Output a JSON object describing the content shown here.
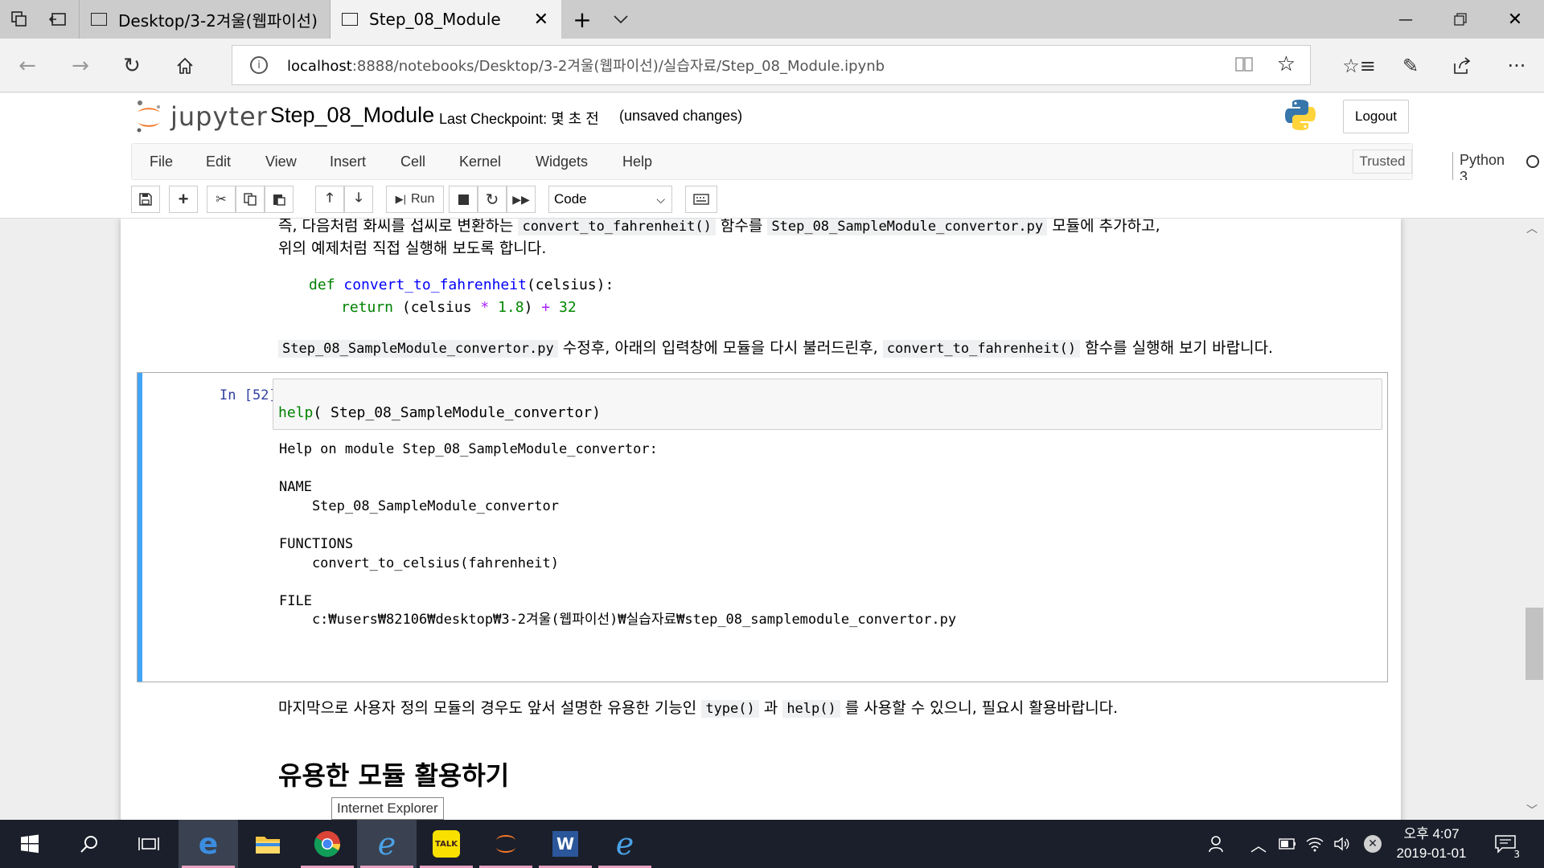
{
  "browser": {
    "tabs": [
      {
        "label": "Desktop/3-2겨울(웹파이선)",
        "active": false
      },
      {
        "label": "Step_08_Module",
        "active": true
      }
    ],
    "url_host": "localhost",
    "url_rest": ":8888/notebooks/Desktop/3-2겨울(웹파이선)/실습자료/Step_08_Module.ipynb"
  },
  "jupyter": {
    "logo_text": "jupyter",
    "notebook_name": "Step_08_Module",
    "checkpoint": "Last Checkpoint: 몇 초 전",
    "unsaved": "(unsaved changes)",
    "logout": "Logout",
    "menu": [
      "File",
      "Edit",
      "View",
      "Insert",
      "Cell",
      "Kernel",
      "Widgets",
      "Help"
    ],
    "trusted": "Trusted",
    "kernel_name": "Python 3",
    "run_label": "Run",
    "cell_type": "Code"
  },
  "content": {
    "md1_line1_a": "즉, 다음처럼 화씨를 섭씨로 변환하는 ",
    "md1_code1": "convert_to_fahrenheit()",
    "md1_line1_b": " 함수를 ",
    "md1_code2": "Step_08_SampleModule_convertor.py",
    "md1_line1_c": " 모듈에 추가하고,",
    "md1_line2": "위의 예제처럼 직접 실행해 보도록 합니다.",
    "code_def_kw": "def",
    "code_def_name": "convert_to_fahrenheit",
    "code_def_args": "(celsius):",
    "code_ret_kw": "return",
    "code_ret_a": " (celsius ",
    "code_ret_op1": "*",
    "code_ret_num1": "1.8",
    "code_ret_b": ") ",
    "code_ret_op2": "+",
    "code_ret_num2": "32",
    "md2_code1": "Step_08_SampleModule_convertor.py",
    "md2_a": " 수정후, 아래의 입력창에 모듈을 다시 불러드린후, ",
    "md2_code2": "convert_to_fahrenheit()",
    "md2_b": " 함수를 실행해 보기 바랍니다.",
    "cell_prompt": "In [52]:",
    "cell_fn": "help",
    "cell_args": "( Step_08_SampleModule_convertor)",
    "output": "Help on module Step_08_SampleModule_convertor:\n\nNAME\n    Step_08_SampleModule_convertor\n\nFUNCTIONS\n    convert_to_celsius(fahrenheit)\n\nFILE\n    c:₩users₩82106₩desktop₩3-2겨울(웹파이선)₩실습자료₩step_08_samplemodule_convertor.py",
    "md3_a": "마지막으로 사용자 정의 모듈의 경우도 앞서 설명한 유용한 기능인 ",
    "md3_code1": "type()",
    "md3_b": " 과 ",
    "md3_code2": "help()",
    "md3_c": " 를 사용할 수 있으니, 필요시 활용바랍니다.",
    "heading": "유용한 모듈 활용하기"
  },
  "tooltip": "Internet Explorer",
  "taskbar": {
    "time": "오후 4:07",
    "date": "2019-01-01",
    "notif_count": "3"
  },
  "colors": {
    "cell_bar": "#42a5f5",
    "prompt": "#303f9f",
    "taskbar": "#1b1f2b"
  }
}
